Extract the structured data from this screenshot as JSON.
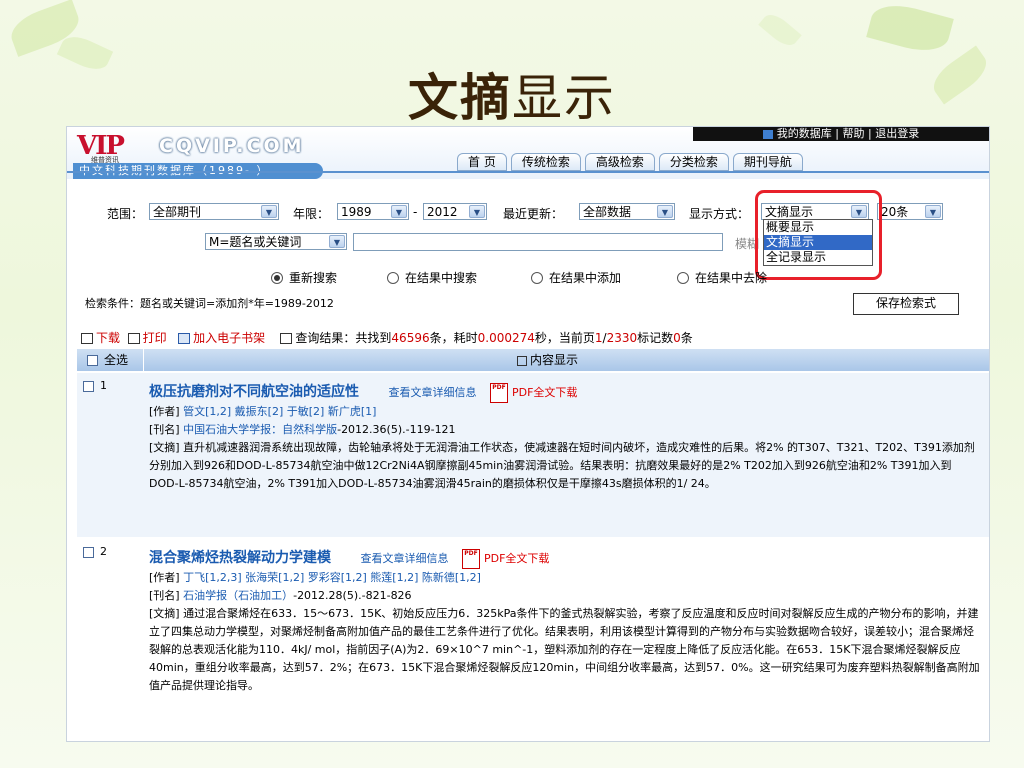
{
  "slide": {
    "title_bold": "文摘",
    "title_rest": "显示"
  },
  "header": {
    "top_links": "我的数据库 | 帮助 | 退出登录",
    "logo_mark": "VIP",
    "logo_sub": "维普资讯",
    "logo_site": "CQVIP.COM",
    "db_name": "中文科技期刊数据库（1989- ）",
    "nav": [
      "首 页",
      "传统检索",
      "高级检索",
      "分类检索",
      "期刊导航"
    ]
  },
  "search": {
    "scope_label": "范围：",
    "scope_value": "全部期刊",
    "year_label": "年限：",
    "year_from": "1989",
    "year_sep": "-",
    "year_to": "2012",
    "update_label": "最近更新：",
    "update_value": "全部数据",
    "display_label": "显示方式：",
    "display_value": "文摘显示",
    "per_page": "20条",
    "field_value": "M=题名或关键词",
    "query_value": "",
    "fuzzy_label": "模糊",
    "display_options": [
      "概要显示",
      "文摘显示",
      "全记录显示"
    ],
    "radios": [
      "重新搜索",
      "在结果中搜索",
      "在结果中添加",
      "在结果中去除"
    ],
    "condition": "检索条件：题名或关键词=添加剂*年=1989-2012",
    "save_button": "保存检索式"
  },
  "toolbar": {
    "download": "下载",
    "print": "打印",
    "ebook": "加入电子书架",
    "result_prefix": "查询结果：共找到",
    "total": "46596",
    "unit": "条，耗时",
    "time": "0.000274",
    "page_prefix": "秒，当前页",
    "page_cur": "1",
    "page_sep": "/",
    "page_total": "2330",
    "mark_prefix": "标记数",
    "mark_count": "0",
    "mark_unit": "条"
  },
  "table": {
    "select_all": "全选",
    "content_header": "内容显示"
  },
  "records": [
    {
      "num": "1",
      "title": "极压抗磨剂对不同航空油的适应性",
      "detail": "查看文章详细信息",
      "pdf": "PDF全文下载",
      "author_label": "[作者]",
      "authors": "管文[1,2] 戴振东[2] 于敏[2] 靳广虎[1]",
      "journal_label": "[刊名]",
      "journal": "中国石油大学学报：自然科学版",
      "journal_info": "-2012.36(5).-119-121",
      "abstract_label": "[文摘]",
      "abstract": "直升机减速器润滑系统出现故障，齿轮轴承将处于无润滑油工作状态，使减速器在短时间内破坏，造成灾难性的后果。将2% 的T307、T321、T202、T391添加剂分别加入到926和DOD-L-85734航空油中做12Cr2Ni4A钢摩擦副45min油雾润滑试验。结果表明：抗磨效果最好的是2% T202加入到926航空油和2% T391加入到DOD-L-85734航空油，2% T391加入DOD-L-85734油雾润滑45rain的磨损体积仅是干摩擦43s磨损体积的1/ 24。"
    },
    {
      "num": "2",
      "title": "混合聚烯烃热裂解动力学建模",
      "detail": "查看文章详细信息",
      "pdf": "PDF全文下载",
      "author_label": "[作者]",
      "authors": "丁飞[1,2,3] 张海荣[1,2] 罗彩容[1,2] 熊莲[1,2] 陈新德[1,2]",
      "journal_label": "[刊名]",
      "journal": "石油学报（石油加工）",
      "journal_info": "-2012.28(5).-821-826",
      "abstract_label": "[文摘]",
      "abstract": "通过混合聚烯烃在633．15～673．15K、初始反应压力6．325kPa条件下的釜式热裂解实验，考察了反应温度和反应时间对裂解反应生成的产物分布的影响，并建立了四集总动力学模型，对聚烯烃制备高附加值产品的最佳工艺条件进行了优化。结果表明，利用该模型计算得到的产物分布与实验数据吻合较好，误差较小；混合聚烯烃裂解的总表观活化能为110．4kJ/ mol，指前因子(A)为2．69×10^7 min^-1，塑料添加剂的存在一定程度上降低了反应活化能。在653．15K下混合聚烯烃裂解反应40min，重组分收率最高，达到57．2%；在673．15K下混合聚烯烃裂解反应120min，中间组分收率最高，达到57．0%。这一研究结果可为废弃塑料热裂解制备高附加值产品提供理论指导。"
    }
  ]
}
